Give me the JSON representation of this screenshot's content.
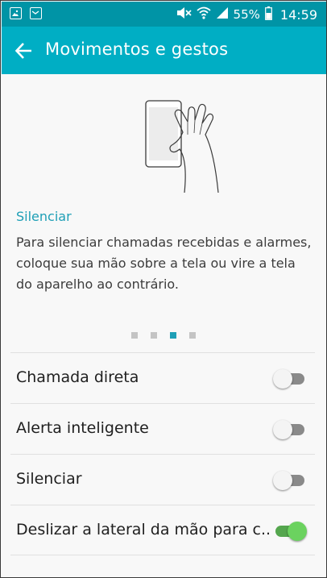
{
  "status_bar": {
    "battery_percent": "55%",
    "time": "14:59",
    "icons": [
      "image-notification-icon",
      "mail-notification-icon",
      "mute-icon",
      "wifi-icon",
      "signal-icon",
      "battery-icon"
    ]
  },
  "toolbar": {
    "title": "Movimentos e gestos",
    "back_icon": "arrow-left-icon"
  },
  "feature": {
    "title": "Silenciar",
    "description": "Para silenciar chamadas recebidas e alarmes, coloque sua mão sobre a tela ou vire a tela do aparelho ao contrário."
  },
  "pager": {
    "count": 4,
    "active_index": 2
  },
  "settings": [
    {
      "label": "Chamada direta",
      "enabled": false
    },
    {
      "label": "Alerta inteligente",
      "enabled": false
    },
    {
      "label": "Silenciar",
      "enabled": false
    },
    {
      "label": "Deslizar a lateral da mão para c..",
      "enabled": true
    }
  ],
  "colors": {
    "status_bar": "#0094a6",
    "toolbar": "#00aec4",
    "accent": "#1e9fb6",
    "switch_on": "#6bd25f"
  }
}
